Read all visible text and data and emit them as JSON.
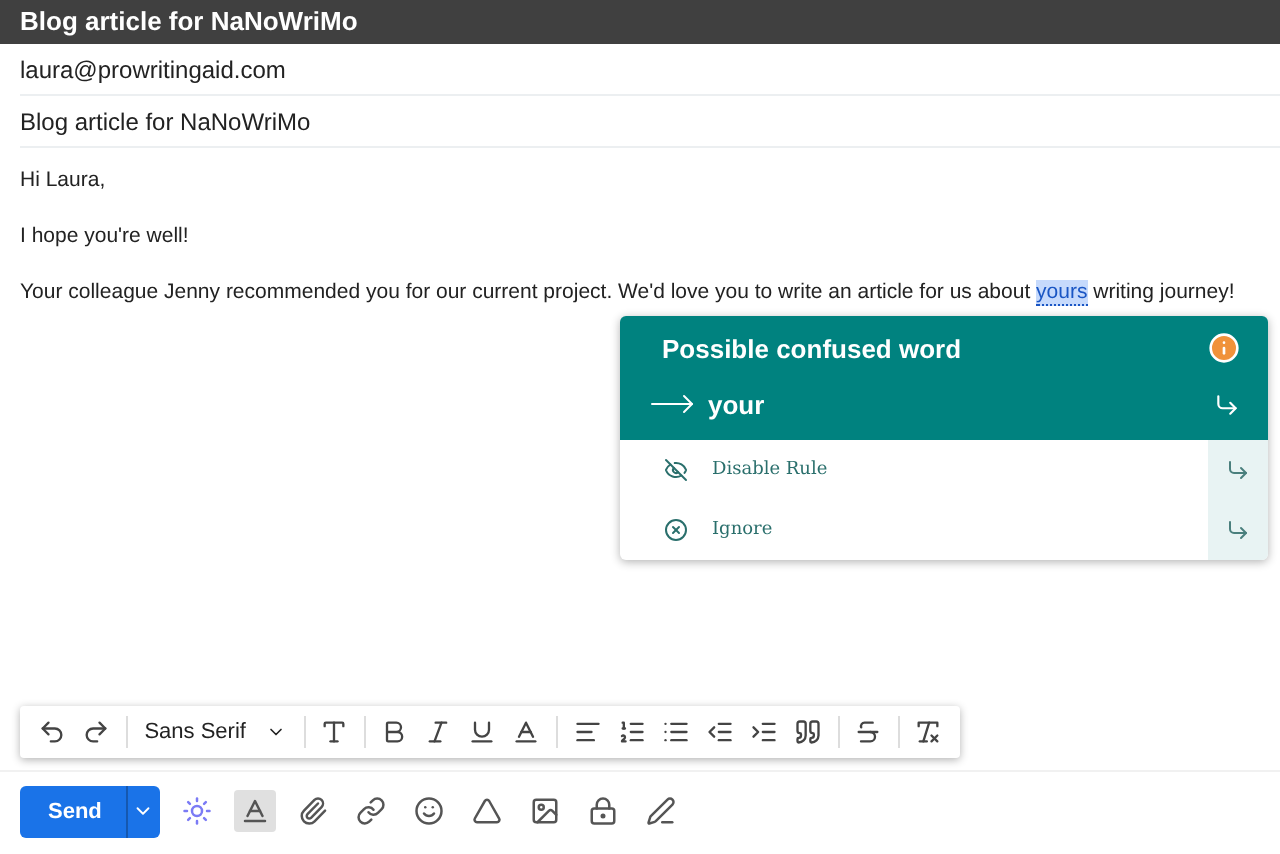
{
  "window": {
    "title": "Blog article for NaNoWriMo"
  },
  "to": "laura@prowritingaid.com",
  "subject": "Blog article for NaNoWriMo",
  "body": [
    {
      "text": "Hi Laura,"
    },
    {
      "text": "I hope you're well!"
    },
    {
      "before": "Your colleague Jenny recommended you for our current project. We'd love you to write an article for us about ",
      "highlight": "yours",
      "after": " writing journey!"
    }
  ],
  "suggestion_popup": {
    "title": "Possible confused word",
    "replacement": "your",
    "actions": [
      {
        "kind": "disable",
        "label": "Disable Rule"
      },
      {
        "kind": "ignore",
        "label": "Ignore"
      }
    ]
  },
  "format_toolbar": {
    "font": "Sans Serif"
  },
  "compose_bar": {
    "send_label": "Send",
    "formatting_selected": true
  }
}
